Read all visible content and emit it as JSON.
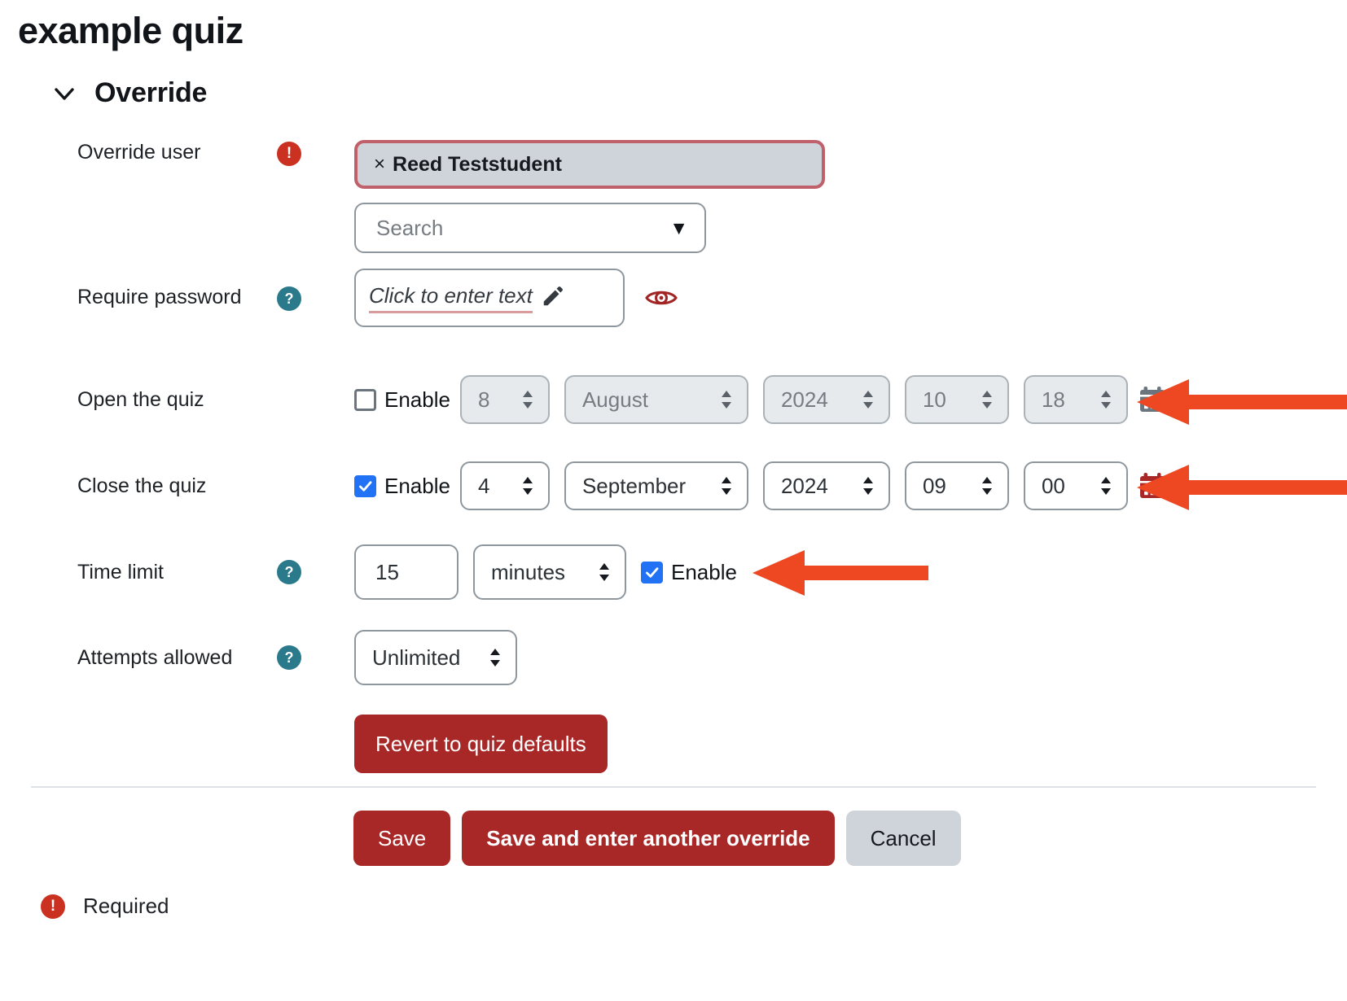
{
  "page": {
    "title": "example quiz",
    "accent_red": "#a82828",
    "annotation_orange": "#ee4823",
    "checkbox_blue": "#2272f5",
    "help_teal": "#2b7a8c",
    "required_red": "#ca3120"
  },
  "section": {
    "title": "Override",
    "chevron_icon": "chevron-down-icon",
    "expanded": true
  },
  "fields": {
    "override_user": {
      "label": "Override user",
      "badge_icon": "required-exclamation-icon",
      "selected_user": "Reed Teststudent",
      "remove_glyph": "×",
      "search_placeholder": "Search",
      "dropdown_icon": "caret-down-icon"
    },
    "require_password": {
      "label": "Require password",
      "badge_icon": "help-question-icon",
      "value_placeholder": "Click to enter text",
      "edit_icon": "pencil-icon",
      "reveal_icon": "eye-icon"
    },
    "open_quiz": {
      "label": "Open the quiz",
      "enable_label": "Enable",
      "enabled": false,
      "day": "8",
      "month": "August",
      "year": "2024",
      "hour": "10",
      "minute": "18",
      "calendar_icon": "calendar-icon"
    },
    "close_quiz": {
      "label": "Close the quiz",
      "enable_label": "Enable",
      "enabled": true,
      "day": "4",
      "month": "September",
      "year": "2024",
      "hour": "09",
      "minute": "00",
      "calendar_icon": "calendar-icon"
    },
    "time_limit": {
      "label": "Time limit",
      "badge_icon": "help-question-icon",
      "value": "15",
      "unit": "minutes",
      "enable_label": "Enable",
      "enabled": true
    },
    "attempts_allowed": {
      "label": "Attempts allowed",
      "badge_icon": "help-question-icon",
      "value": "Unlimited"
    }
  },
  "buttons": {
    "revert": "Revert to quiz defaults",
    "save": "Save",
    "save_another": "Save and enter another override",
    "cancel": "Cancel"
  },
  "footer": {
    "required_label": "Required",
    "badge_icon": "required-exclamation-icon"
  },
  "annotations": [
    {
      "name": "arrow-open-quiz-calendar",
      "points_to": "open-quiz-calendar-icon"
    },
    {
      "name": "arrow-close-quiz-calendar",
      "points_to": "close-quiz-calendar-icon"
    },
    {
      "name": "arrow-time-limit-enable",
      "points_to": "time-limit-enable-checkbox"
    }
  ]
}
